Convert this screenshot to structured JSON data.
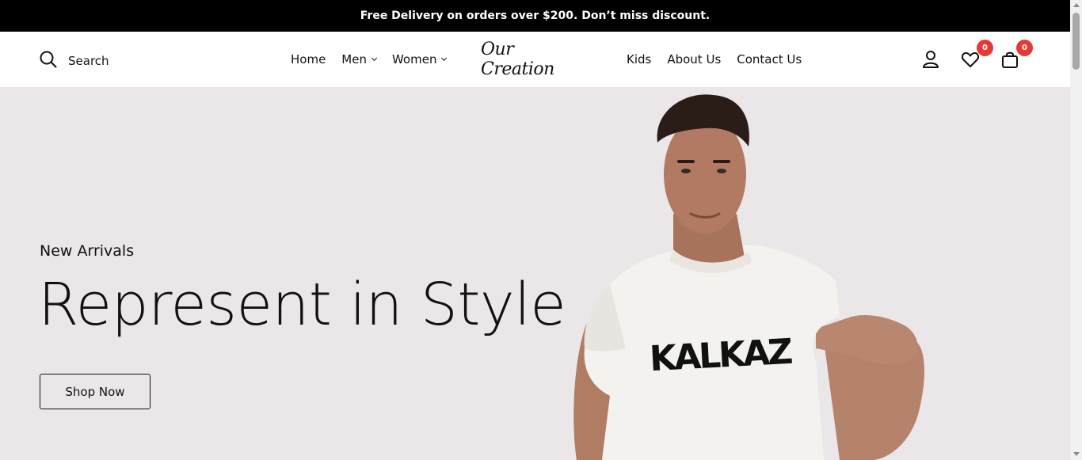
{
  "announcement": "Free Delivery on orders over $200. Don’t miss discount.",
  "search": {
    "label": "Search",
    "icon": "search-icon"
  },
  "nav_left": [
    {
      "label": "Home",
      "dropdown": false
    },
    {
      "label": "Men",
      "dropdown": true
    },
    {
      "label": "Women",
      "dropdown": true
    }
  ],
  "logo": {
    "text": "Our Creation"
  },
  "nav_right": [
    {
      "label": "Kids"
    },
    {
      "label": "About Us"
    },
    {
      "label": "Contact Us"
    }
  ],
  "header_icons": {
    "account": "user-icon",
    "wishlist": {
      "icon": "heart-icon",
      "count": "0"
    },
    "cart": {
      "icon": "shopping-bag-icon",
      "count": "0"
    }
  },
  "hero": {
    "subtitle": "New Arrivals",
    "title": "Represent in Style",
    "button": "Shop Now",
    "shirt_print": "KALKAZ"
  },
  "colors": {
    "topbar_bg": "#000000",
    "hero_bg": "#ebe7e8",
    "badge": "#e53935"
  }
}
